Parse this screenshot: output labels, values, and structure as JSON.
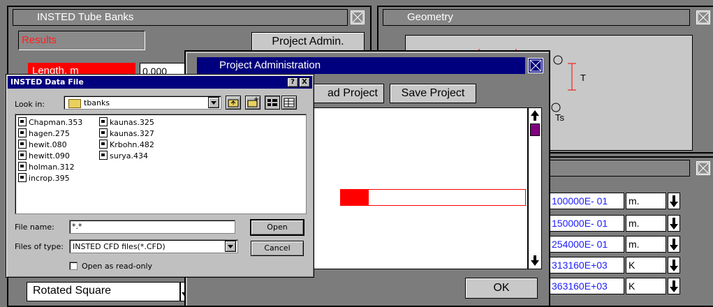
{
  "tubebanks": {
    "title": "INSTED Tube Banks",
    "results_label": "Results",
    "project_admin_button": "Project Admin.",
    "length_label": "Length, m",
    "length_value": "0.000",
    "arrangement_value": "Rotated Square"
  },
  "geometry": {
    "title": "Geometry",
    "label_t": "T",
    "label_ts": "Ts"
  },
  "params": {
    "rows": [
      {
        "value": "100000E- 01",
        "unit": "m."
      },
      {
        "value": "150000E- 01",
        "unit": "m."
      },
      {
        "value": "254000E- 01",
        "unit": "m."
      },
      {
        "value": "313160E+03",
        "unit": "K"
      },
      {
        "value": "363160E+03",
        "unit": "K"
      }
    ]
  },
  "project_admin": {
    "title": "Project Administration",
    "load_button": "ad Project",
    "save_button": "Save Project",
    "ok_button": "OK"
  },
  "file_dialog": {
    "title": "INSTED Data File",
    "help_button": "?",
    "close_button": "X",
    "look_in_label": "Look in:",
    "look_in_value": "tbanks",
    "files_col1": [
      "Chapman.353",
      "hagen.275",
      "hewit.080",
      "hewitt.090",
      "holman.312",
      "incrop.395"
    ],
    "files_col2": [
      "kaunas.325",
      "kaunas.327",
      "Krbohn.482",
      "surya.434"
    ],
    "file_name_label": "File name:",
    "file_name_value": "*.*",
    "files_of_type_label": "Files of type:",
    "files_of_type_value": "INSTED CFD files(*.CFD)",
    "open_button": "Open",
    "cancel_button": "Cancel",
    "readonly_label": "Open as read-only"
  },
  "colors": {
    "accent_red": "#ff0000",
    "title_blue": "#00007e",
    "value_blue": "#1c1cff",
    "scroll_purple": "#800080"
  }
}
